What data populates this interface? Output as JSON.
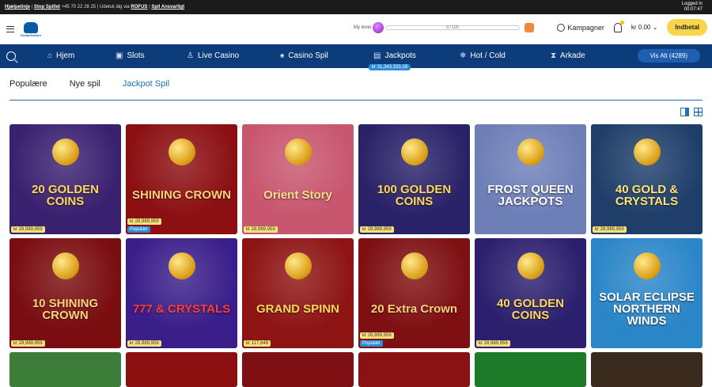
{
  "topbar": {
    "help": "Hjælpelinje",
    "stop": "Stop Spillet",
    "phone": "+45 70 22 28 25",
    "exclude_prefix": "Udeluk dig via",
    "rofus": "ROFUS",
    "responsible": "Spil Ansvarligt",
    "logged_in": "Logged in",
    "time": "00:07:47"
  },
  "header": {
    "logo_text": "DreamCasino",
    "level_label": "My level",
    "progress_text": "0 / 125",
    "progress_fraction": 0,
    "campaigns": "Kampagner",
    "balance": "kr 0.00",
    "deposit": "Indbetal"
  },
  "nav": {
    "items": [
      {
        "label": "Hjem",
        "icon": "home-icon"
      },
      {
        "label": "Slots",
        "icon": "slots-icon"
      },
      {
        "label": "Live Casino",
        "icon": "live-casino-icon"
      },
      {
        "label": "Casino Spil",
        "icon": "casino-games-icon"
      },
      {
        "label": "Jackpots",
        "icon": "jackpots-icon"
      },
      {
        "label": "Hot / Cold",
        "icon": "snowflake-icon"
      },
      {
        "label": "Arkade",
        "icon": "arcade-icon"
      }
    ],
    "jackpot_amount": "kr 31,343,333.28",
    "see_all": "Vis Alt (4289)"
  },
  "tabs": [
    "Populære",
    "Nye spil",
    "Jackpot Spil"
  ],
  "active_tab": 2,
  "games": [
    {
      "title": "20 GOLDEN COINS",
      "jackpot": "kr 28,989,959",
      "badge": "",
      "bg": "#3a2170",
      "fg": "#ffd75a"
    },
    {
      "title": "SHINING CROWN",
      "jackpot": "kr 28,989,959",
      "badge": "Populær",
      "bg": "#8c0f12",
      "fg": "#ffd27a"
    },
    {
      "title": "Orient Story",
      "jackpot": "kr 28,989,959",
      "badge": "",
      "bg": "#c8566f",
      "fg": "#ffe08a"
    },
    {
      "title": "100 GOLDEN COINS",
      "jackpot": "kr 28,989,959",
      "badge": "",
      "bg": "#2a2268",
      "fg": "#ffd75a"
    },
    {
      "title": "FROST QUEEN JACKPOTS",
      "jackpot": "",
      "badge": "",
      "bg": "#6e7fb8",
      "fg": "#ffffff"
    },
    {
      "title": "40 GOLD & CRYSTALS",
      "jackpot": "kr 28,989,959",
      "badge": "",
      "bg": "#1f3f6a",
      "fg": "#ffe27a"
    },
    {
      "title": "10 SHINING CROWN",
      "jackpot": "kr 28,989,959",
      "badge": "",
      "bg": "#7a0d10",
      "fg": "#ffd27a"
    },
    {
      "title": "777 & CRYSTALS",
      "jackpot": "kr 28,989,959",
      "badge": "",
      "bg": "#3a1e8a",
      "fg": "#ff3b3b"
    },
    {
      "title": "GRAND SPINN",
      "jackpot": "kr 117,848",
      "badge": "",
      "bg": "#8e1414",
      "fg": "#ffd75a"
    },
    {
      "title": "20 Extra Crown",
      "jackpot": "kr 28,989,959",
      "badge": "Populær",
      "bg": "#7e0f12",
      "fg": "#ffd27a"
    },
    {
      "title": "40 GOLDEN COINS",
      "jackpot": "kr 28,989,959",
      "badge": "",
      "bg": "#2b1f6e",
      "fg": "#ffd75a"
    },
    {
      "title": "SOLAR ECLIPSE NORTHERN WINDS",
      "jackpot": "",
      "badge": "",
      "bg": "#2b86c8",
      "fg": "#ffffff"
    }
  ],
  "row3_colors": [
    "#3d7d3a",
    "#8c1010",
    "#7e1014",
    "#8a1212",
    "#1d7a28",
    "#3a2a1e"
  ]
}
